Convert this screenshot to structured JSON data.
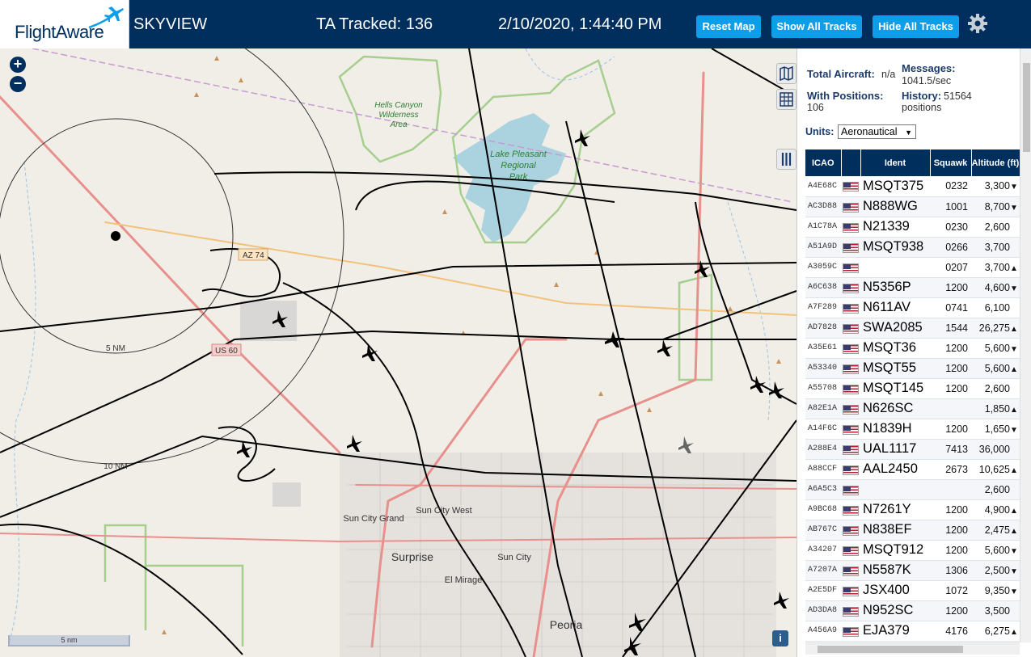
{
  "header": {
    "logo": "FlightAware",
    "app_title": "SKYVIEW",
    "tracked": "TA Tracked: 136",
    "datetime": "2/10/2020, 1:44:40 PM",
    "buttons": {
      "reset": "Reset Map",
      "show": "Show All Tracks",
      "hide": "Hide All Tracks"
    },
    "settings_icon": "gear-icon",
    "brand_color": "#002f5d",
    "button_color": "#0d9ee9"
  },
  "map": {
    "zoom_in": "+",
    "zoom_out": "−",
    "place_labels": {
      "hells_canyon": [
        "Hells Canyon",
        "Wilderness",
        "Area"
      ],
      "lake_pleasant": [
        "Lake Pleasant",
        "Regional",
        "Park"
      ],
      "sun_city_grand": "Sun City Grand",
      "sun_city_west": "Sun City West",
      "surprise": "Surprise",
      "sun_city": "Sun City",
      "el_mirage": "El Mirage",
      "peoria": "Peoria"
    },
    "road_labels": {
      "az74": "AZ 74",
      "us60": "US 60"
    },
    "range_rings": [
      "5 NM",
      "10 NM"
    ],
    "scale": "5 nm",
    "info": "i",
    "tool_icons": [
      "map-icon",
      "grid-icon",
      "columns-icon"
    ]
  },
  "sidebar": {
    "total_aircraft_label": "Total Aircraft:",
    "total_aircraft_value": "n/a",
    "messages_label": "Messages:",
    "messages_value": "1041.5/sec",
    "with_positions_label": "With Positions:",
    "with_positions_value": "106",
    "history_label": "History:",
    "history_value": "51564",
    "history_unit": "positions",
    "units_label": "Units:",
    "units_value": "Aeronautical",
    "columns": [
      "ICAO",
      "",
      "Ident",
      "Squawk",
      "Altitude (ft)"
    ],
    "rows": [
      {
        "icao": "A4E68C",
        "ident": "MSQT375",
        "squawk": "0232",
        "alt": "3,300",
        "trend": "▼"
      },
      {
        "icao": "AC3D88",
        "ident": "N888WG",
        "squawk": "1001",
        "alt": "8,700",
        "trend": "▼"
      },
      {
        "icao": "A1C78A",
        "ident": "N21339",
        "squawk": "0230",
        "alt": "2,600",
        "trend": ""
      },
      {
        "icao": "A51A9D",
        "ident": "MSQT938",
        "squawk": "0266",
        "alt": "3,700",
        "trend": ""
      },
      {
        "icao": "A3059C",
        "ident": "",
        "squawk": "0207",
        "alt": "3,700",
        "trend": "▲"
      },
      {
        "icao": "A6C638",
        "ident": "N5356P",
        "squawk": "1200",
        "alt": "4,600",
        "trend": "▼"
      },
      {
        "icao": "A7F289",
        "ident": "N611AV",
        "squawk": "0741",
        "alt": "6,100",
        "trend": ""
      },
      {
        "icao": "AD7828",
        "ident": "SWA2085",
        "squawk": "1544",
        "alt": "26,275",
        "trend": "▲"
      },
      {
        "icao": "A35E61",
        "ident": "MSQT36",
        "squawk": "1200",
        "alt": "5,600",
        "trend": "▼"
      },
      {
        "icao": "A53340",
        "ident": "MSQT55",
        "squawk": "1200",
        "alt": "5,600",
        "trend": "▲"
      },
      {
        "icao": "A55708",
        "ident": "MSQT145",
        "squawk": "1200",
        "alt": "2,600",
        "trend": ""
      },
      {
        "icao": "A82E1A",
        "ident": "N626SC",
        "squawk": "",
        "alt": "1,850",
        "trend": "▲"
      },
      {
        "icao": "A14F6C",
        "ident": "N1839H",
        "squawk": "1200",
        "alt": "1,650",
        "trend": "▼"
      },
      {
        "icao": "A288E4",
        "ident": "UAL1117",
        "squawk": "7413",
        "alt": "36,000",
        "trend": ""
      },
      {
        "icao": "A88CCF",
        "ident": "AAL2450",
        "squawk": "2673",
        "alt": "10,625",
        "trend": "▲"
      },
      {
        "icao": "A6A5C3",
        "ident": "",
        "squawk": "",
        "alt": "2,600",
        "trend": ""
      },
      {
        "icao": "A9BC68",
        "ident": "N7261Y",
        "squawk": "1200",
        "alt": "4,900",
        "trend": "▲"
      },
      {
        "icao": "AB767C",
        "ident": "N838EF",
        "squawk": "1200",
        "alt": "2,475",
        "trend": "▲"
      },
      {
        "icao": "A34207",
        "ident": "MSQT912",
        "squawk": "1200",
        "alt": "5,600",
        "trend": "▼"
      },
      {
        "icao": "A7207A",
        "ident": "N5587K",
        "squawk": "1306",
        "alt": "2,500",
        "trend": "▼"
      },
      {
        "icao": "A2E5DF",
        "ident": "JSX400",
        "squawk": "1072",
        "alt": "9,350",
        "trend": "▼"
      },
      {
        "icao": "AD3DA8",
        "ident": "N952SC",
        "squawk": "1200",
        "alt": "3,500",
        "trend": ""
      },
      {
        "icao": "A456A9",
        "ident": "EJA379",
        "squawk": "4176",
        "alt": "6,275",
        "trend": "▲"
      }
    ]
  }
}
